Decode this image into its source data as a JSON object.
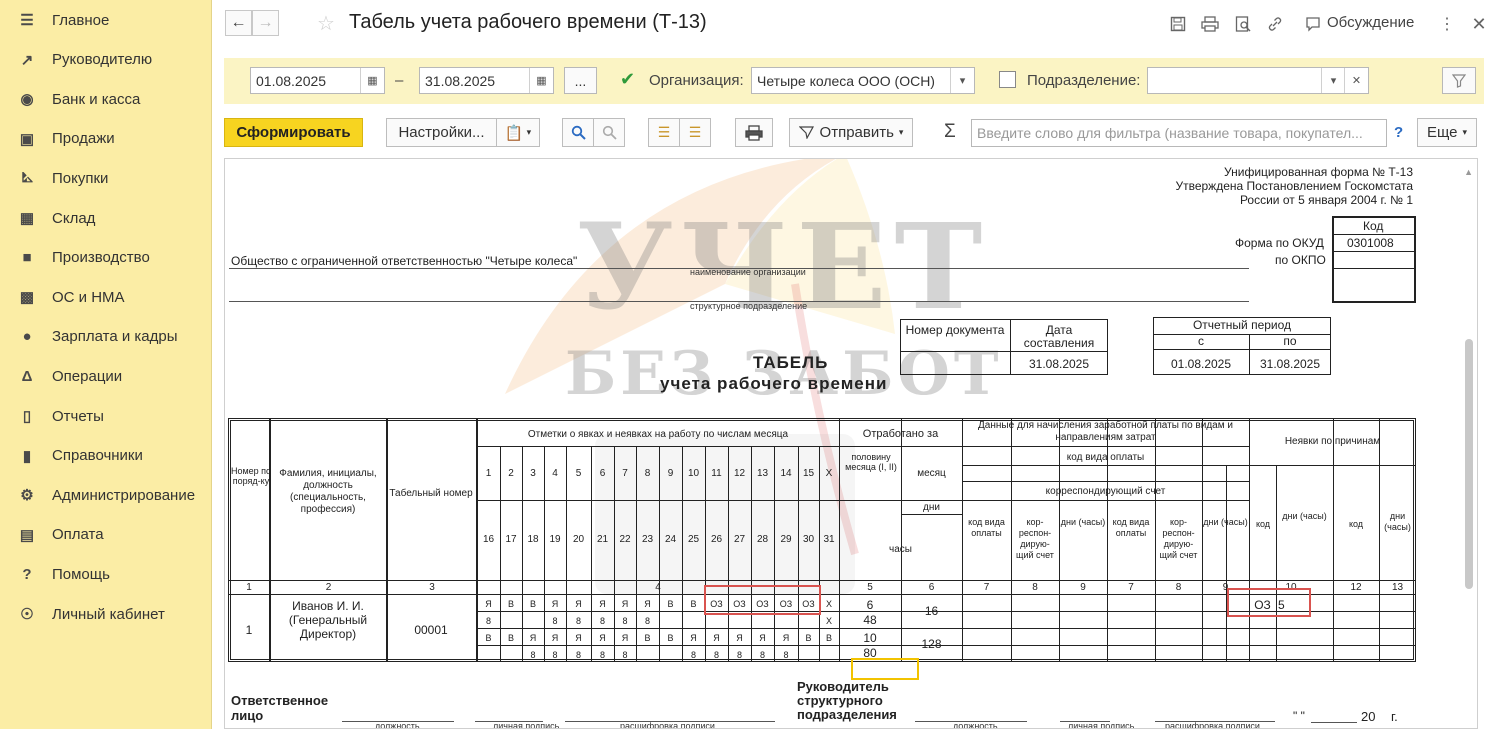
{
  "sidebar": {
    "items": [
      {
        "label": "Главное",
        "icon": "menu-icon"
      },
      {
        "label": "Руководителю",
        "icon": "trend-icon"
      },
      {
        "label": "Банк и касса",
        "icon": "coin-icon"
      },
      {
        "label": "Продажи",
        "icon": "bag-icon"
      },
      {
        "label": "Покупки",
        "icon": "cart-icon"
      },
      {
        "label": "Склад",
        "icon": "grid-icon"
      },
      {
        "label": "Производство",
        "icon": "factory-icon"
      },
      {
        "label": "ОС и НМА",
        "icon": "truck-icon"
      },
      {
        "label": "Зарплата и кадры",
        "icon": "person-icon"
      },
      {
        "label": "Операции",
        "icon": "dtkt-icon"
      },
      {
        "label": "Отчеты",
        "icon": "barchart-icon"
      },
      {
        "label": "Справочники",
        "icon": "book-icon"
      },
      {
        "label": "Администрирование",
        "icon": "gear-icon"
      },
      {
        "label": "Оплата",
        "icon": "wallet-icon"
      },
      {
        "label": "Помощь",
        "icon": "question-icon"
      },
      {
        "label": "Личный кабинет",
        "icon": "user-circle-icon"
      }
    ]
  },
  "header": {
    "title": "Табель учета рабочего времени (Т-13)",
    "discuss": "Обсуждение"
  },
  "filter": {
    "date_from": "01.08.2025",
    "dash": "–",
    "date_to": "31.08.2025",
    "ellipsis": "...",
    "org_label": "Организация:",
    "org_value": "Четыре колеса ООО (ОСН)",
    "dept_label": "Подразделение:",
    "dept_value": ""
  },
  "toolbar": {
    "generate": "Сформировать",
    "settings": "Настройки...",
    "send": "Отправить",
    "sigma": "Σ",
    "search_placeholder": "Введите слово для фильтра (название товара, покупател...",
    "help": "?",
    "more": "Еще"
  },
  "report": {
    "form_lines": [
      "Унифицированная форма № Т-13",
      "Утверждена Постановлением Госкомстата",
      "России от 5 января 2004 г. № 1"
    ],
    "code_header": "Код",
    "okud_label": "Форма по ОКУД",
    "okud_value": "0301008",
    "okpo_label": "по ОКПО",
    "org_name": "Общество с ограниченной ответственностью \"Четыре колеса\"",
    "org_caption": "наименование организации",
    "dept_caption": "структурное подразделение",
    "doc_number_header": "Номер документа",
    "doc_date_header": "Дата составления",
    "doc_date": "31.08.2025",
    "period_header": "Отчетный период",
    "period_from_label": "с",
    "period_to_label": "по",
    "period_from": "01.08.2025",
    "period_to": "31.08.2025",
    "title1": "ТАБЕЛЬ",
    "title2": "учета рабочего времени",
    "watermark1": "УЧЕТ",
    "watermark2": "БЕЗ ЗАБОТ",
    "table": {
      "h_num": "Номер по поряд-ку",
      "h_name": "Фамилия, инициалы, должность (специальность, профессия)",
      "h_tab": "Табельный номер",
      "h_marks": "Отметки о явках и неявках на работу по числам месяца",
      "h_worked": "Отработано за",
      "h_half": "половину месяца (I, II)",
      "h_month": "месяц",
      "h_days": "дни",
      "h_hours": "часы",
      "h_pay": "Данные для начисления заработной платы по видам и направлениям затрат",
      "h_pay_code": "код вида оплаты",
      "h_corr": "корреспондирующий счет",
      "h_code_pay": "код вида оплаты",
      "h_corr_short": "кор-респон-дирую-щий счет",
      "h_dh": "дни (часы)",
      "h_absence": "Неявки по причинам",
      "h_code": "код",
      "days_top": [
        "1",
        "2",
        "3",
        "4",
        "5",
        "6",
        "7",
        "8",
        "9",
        "10",
        "11",
        "12",
        "13",
        "14",
        "15",
        "X"
      ],
      "days_bottom": [
        "16",
        "17",
        "18",
        "19",
        "20",
        "21",
        "22",
        "23",
        "24",
        "25",
        "26",
        "27",
        "28",
        "29",
        "30",
        "31"
      ],
      "col_numbers": [
        "1",
        "2",
        "3",
        "4",
        "5",
        "6",
        "7",
        "8",
        "9",
        "7",
        "8",
        "9",
        "10",
        "11",
        "12",
        "13"
      ],
      "row": {
        "num": "1",
        "name": "Иванов И. И. (Генеральный Директор)",
        "tab": "00001",
        "marks1": [
          "Я",
          "В",
          "В",
          "Я",
          "Я",
          "Я",
          "Я",
          "Я",
          "В",
          "В",
          "ОЗ",
          "ОЗ",
          "ОЗ",
          "ОЗ",
          "ОЗ",
          "X"
        ],
        "hours1": [
          "8",
          "",
          "",
          "8",
          "8",
          "8",
          "8",
          "8",
          "",
          "",
          "",
          "",
          "",
          "",
          "",
          "X"
        ],
        "marks2": [
          "В",
          "В",
          "Я",
          "Я",
          "Я",
          "Я",
          "Я",
          "В",
          "В",
          "Я",
          "Я",
          "Я",
          "Я",
          "Я",
          "В",
          "В"
        ],
        "hours2": [
          "",
          "",
          "8",
          "8",
          "8",
          "8",
          "8",
          "",
          "",
          "8",
          "8",
          "8",
          "8",
          "8",
          "",
          ""
        ],
        "half1_days": "6",
        "half1_hours": "48",
        "half2_days": "10",
        "half2_hours": "80",
        "month_days": "16",
        "month_hours": "128",
        "abs_code": "ОЗ",
        "abs_days": "5"
      }
    },
    "footer": {
      "responsible": "Ответственное лицо",
      "head": "Руководитель структурного подразделения",
      "position": "должность",
      "signature": "личная подпись",
      "decode": "расшифровка подписи",
      "date_quote": "\" \"",
      "year": "20",
      "year_suffix": "г."
    }
  }
}
